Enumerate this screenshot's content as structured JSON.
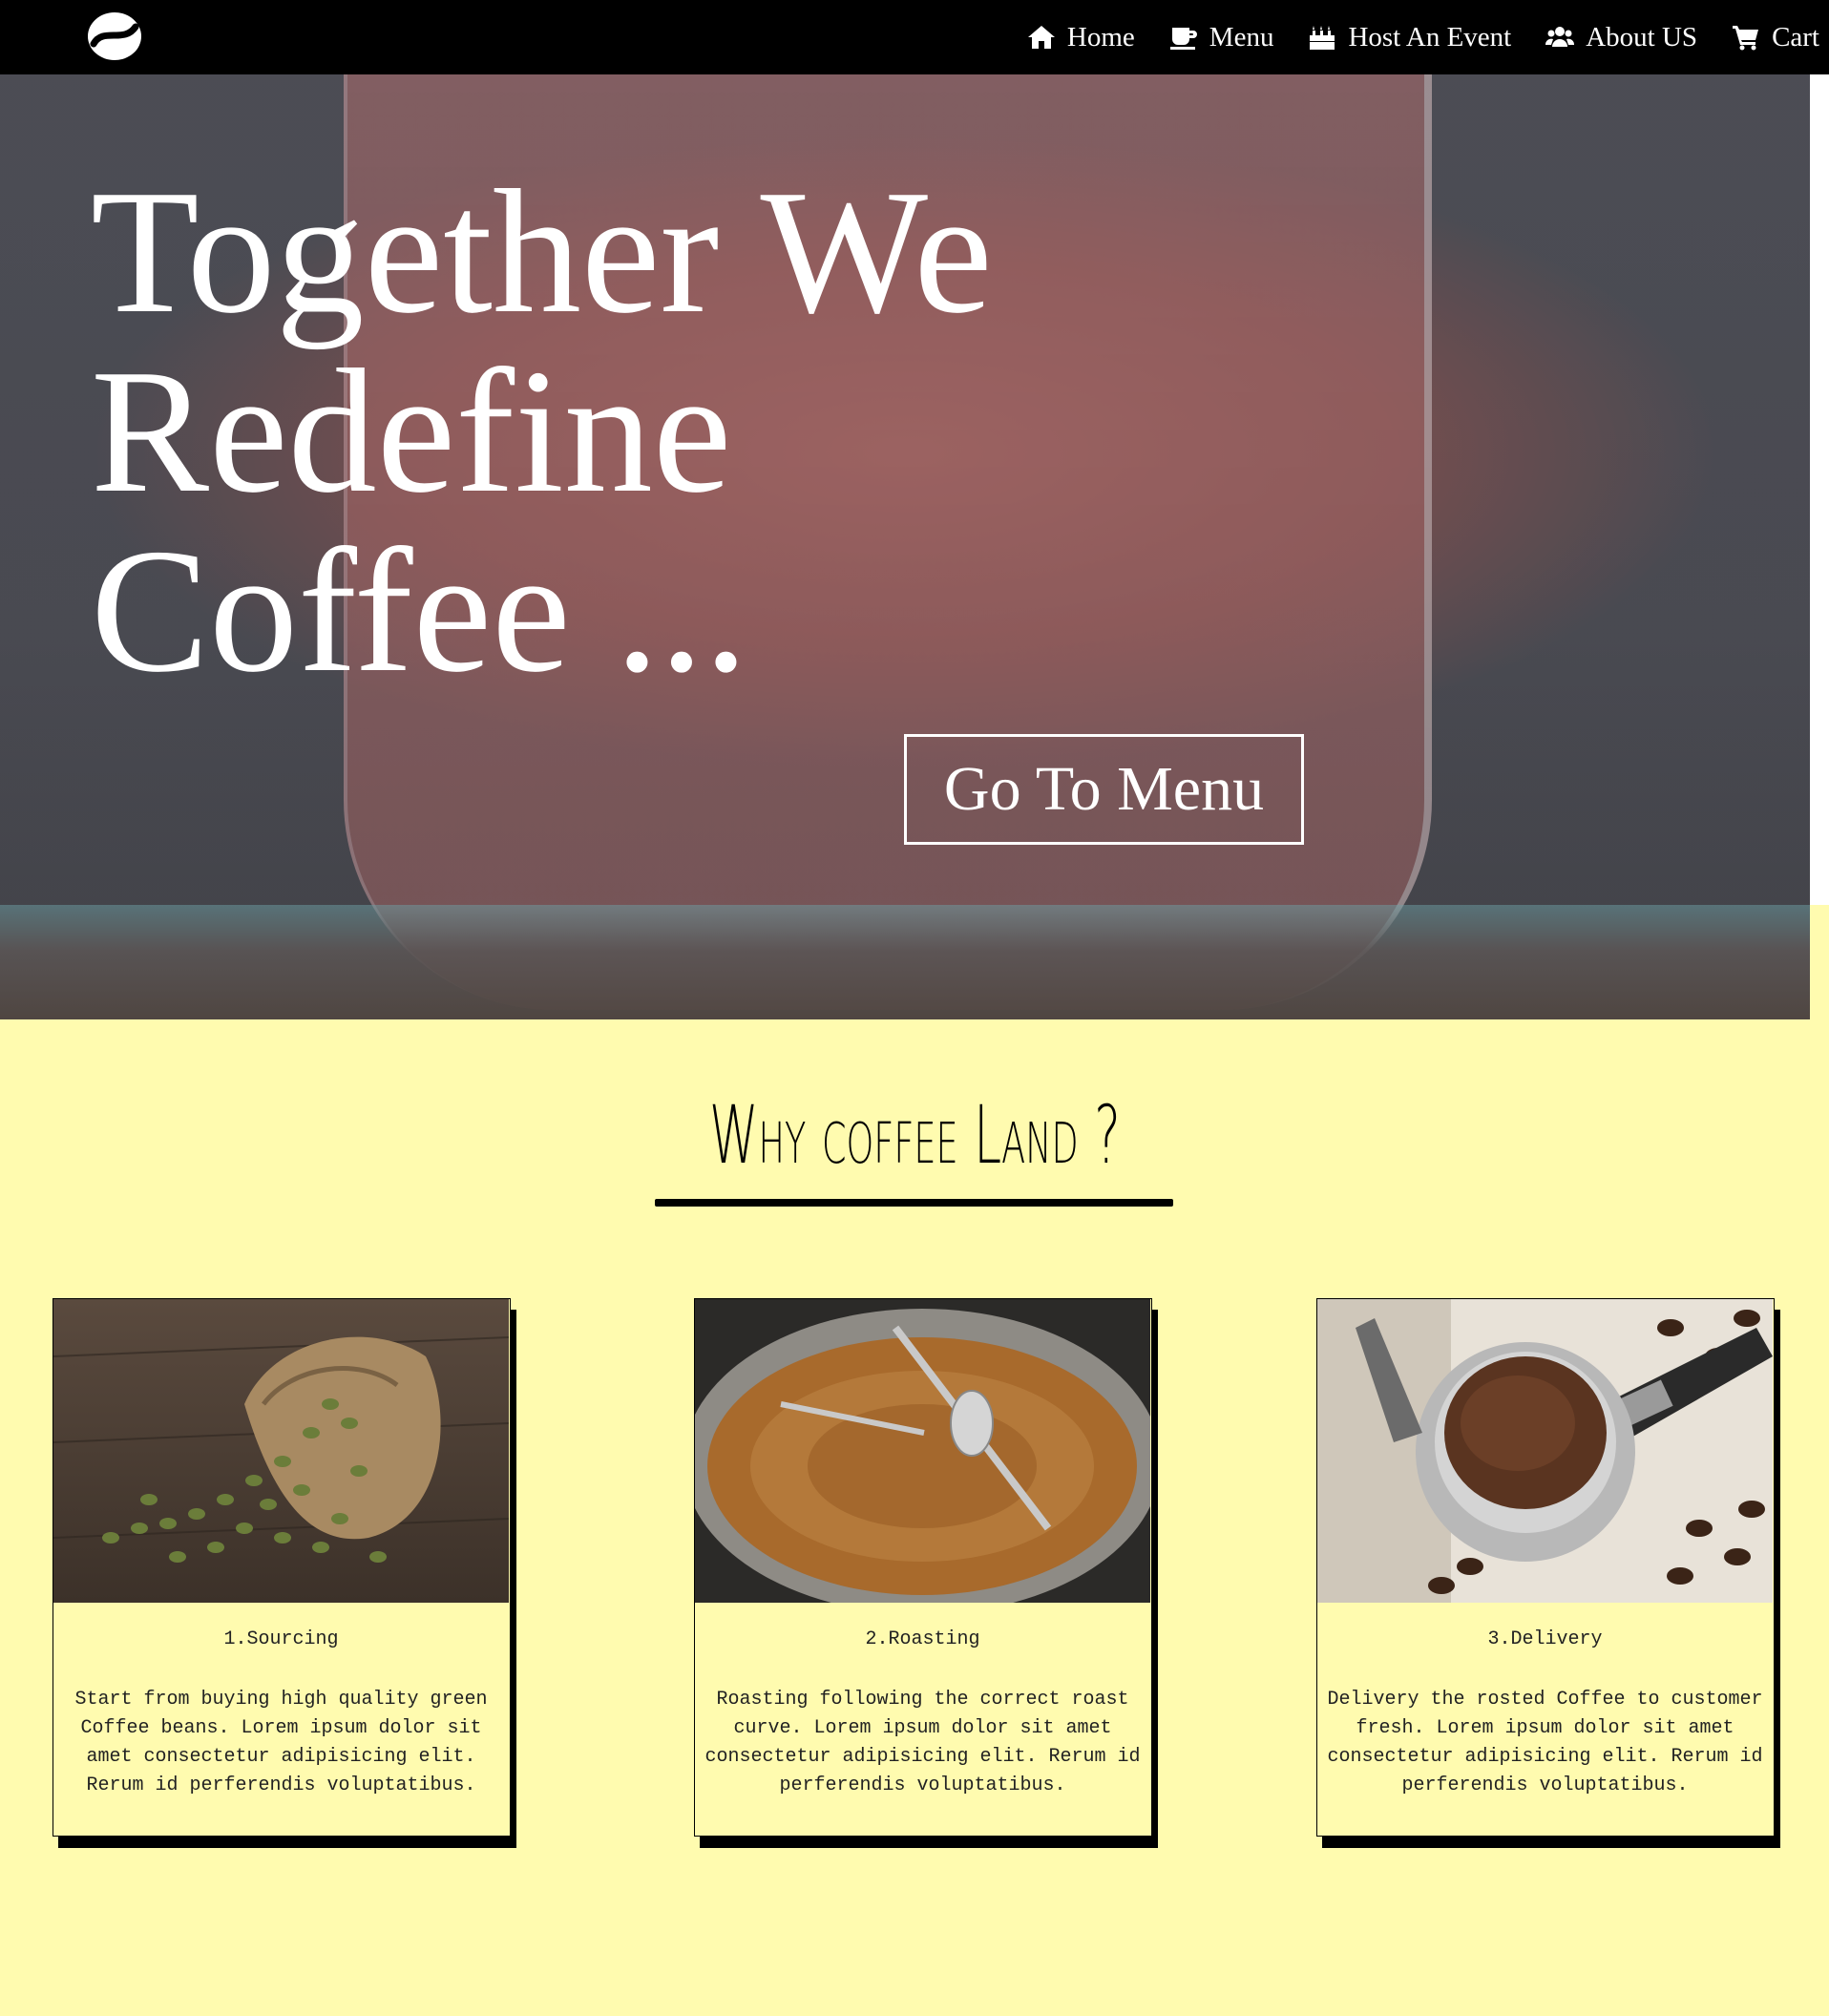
{
  "nav": {
    "items": [
      {
        "label": "Home",
        "icon": "home-icon"
      },
      {
        "label": "Menu",
        "icon": "coffee-cup-icon"
      },
      {
        "label": "Host An Event",
        "icon": "birthday-cake-icon"
      },
      {
        "label": "About US",
        "icon": "users-icon"
      },
      {
        "label": "Cart",
        "icon": "shopping-cart-icon"
      }
    ]
  },
  "hero": {
    "title_lines": [
      "Together We",
      "Redefine",
      "Coffee ..."
    ],
    "button_label": "Go To Menu"
  },
  "section": {
    "title": "Why coffee Land ?"
  },
  "cards": [
    {
      "heading": "1.Sourcing",
      "text": "Start from buying high quality green Coffee beans. Lorem ipsum dolor sit amet consectetur adipisicing elit. Rerum id perferendis voluptatibus."
    },
    {
      "heading": "2.Roasting",
      "text": "Roasting following the correct roast curve. Lorem ipsum dolor sit amet consectetur adipisicing elit. Rerum id perferendis voluptatibus."
    },
    {
      "heading": "3.Delivery",
      "text": "Delivery the rosted Coffee to customer fresh. Lorem ipsum dolor sit amet consectetur adipisicing elit. Rerum id perferendis voluptatibus."
    }
  ],
  "colors": {
    "navbar": "#000000",
    "page_background": "#fffbaf",
    "hero_text": "#ffffff"
  }
}
